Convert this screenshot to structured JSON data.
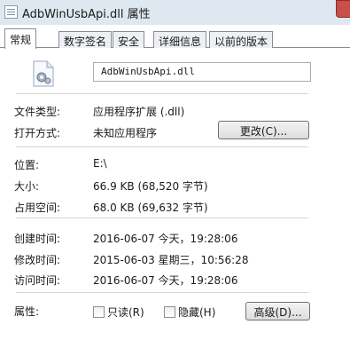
{
  "window": {
    "title": "AdbWinUsbApi.dll 属性"
  },
  "tabs": [
    "常规",
    "数字签名",
    "安全",
    "详细信息",
    "以前的版本"
  ],
  "general": {
    "filename": "AdbWinUsbApi.dll",
    "file_type_label": "文件类型:",
    "file_type_value": "应用程序扩展 (.dll)",
    "opens_with_label": "打开方式:",
    "opens_with_value": "未知应用程序",
    "change_button": "更改(C)...",
    "location_label": "位置:",
    "location_value": "E:\\",
    "size_label": "大小:",
    "size_value": "66.9 KB (68,520 字节)",
    "size_on_disk_label": "占用空间:",
    "size_on_disk_value": "68.0 KB (69,632 字节)",
    "created_label": "创建时间:",
    "created_value": "2016-06-07 今天，19:28:06",
    "modified_label": "修改时间:",
    "modified_value": "2015-06-03 星期三，10:56:28",
    "accessed_label": "访问时间:",
    "accessed_value": "2016-06-07 今天，19:28:06",
    "attributes_label": "属性:",
    "readonly_label": "只读(R)",
    "readonly_checked": false,
    "hidden_label": "隐藏(H)",
    "hidden_checked": false,
    "advanced_button": "高级(D)..."
  }
}
